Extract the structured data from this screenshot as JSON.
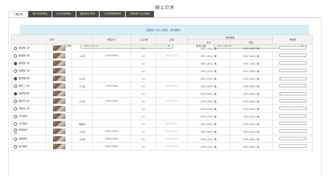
{
  "page_title": "線上訂房",
  "tabs": [
    "一般訂房",
    "親子四季專案",
    "日式柏城專案",
    "暢遊學生專案",
    "住宿連開餐專案",
    "寒假親子合住專案"
  ],
  "notice": "若要有×元住×優惠，請勿看見！",
  "checkin": {
    "label": "入住日期：",
    "value": "2017-05-11"
  },
  "checkout": {
    "label": "退房日期：",
    "value": "2017-05-12"
  },
  "table": {
    "headers": {
      "room": "房型",
      "size": "房間尺寸",
      "people": "入住人數",
      "full": "全價",
      "price_group": "優惠價格",
      "weekday": "平日",
      "holiday": "假日",
      "qty": "房間數"
    },
    "rows": [
      {
        "name": "雅致雙人房",
        "checked": false,
        "size": "",
        "bed": "",
        "people": "1人",
        "full": "",
        "weekday": "NT$ 2,650 / 晚",
        "holiday": "NT$ 2,960 / 晚",
        "qty": ""
      },
      {
        "name": "雅致雙人房",
        "checked": false,
        "size": "1大床",
        "bed": "150×190cm",
        "people": "2人",
        "full": "NT$ 4,200",
        "weekday": "NT$ 2,950 / 晚",
        "holiday": "NT$ 3,460 / 晚",
        "qty": ""
      },
      {
        "name": "雅致雙人房",
        "checked": true,
        "size": "",
        "bed": "",
        "people": "1人",
        "full": "",
        "weekday": "NT$ 2,850 / 晚",
        "holiday": "NT$ 3,160 / 晚",
        "qty": ""
      },
      {
        "name": "景緻雙人房",
        "checked": false,
        "size": "",
        "bed": "",
        "people": "2人",
        "full": "",
        "weekday": "NT$ 3,150 / 晚",
        "holiday": "NT$ 3,660 / 晚",
        "qty": ""
      },
      {
        "name": "雅致雙床房",
        "checked": true,
        "size": "2小床",
        "bed": "",
        "people": "1人",
        "full": "",
        "weekday": "NT$ 3,150 / 晚",
        "holiday": "NT$ 3,460 / 晚",
        "qty": "1"
      },
      {
        "name": "雅致三人房",
        "checked": false,
        "size": "2小床",
        "bed": "120×190cm",
        "people": "2人",
        "full": "NT$ 4,800",
        "weekday": "NT$ 3,000 / 晚",
        "holiday": "NT$ 3,960 / 晚",
        "qty": ""
      },
      {
        "name": "景緻雙床房",
        "checked": true,
        "size": "",
        "bed": "",
        "people": "2人",
        "full": "",
        "weekday": "NT$ 3,600 / 晚",
        "holiday": "NT$ 4,060 / 晚",
        "qty": "1"
      },
      {
        "name": "雅致四人房",
        "checked": false,
        "size": "2中床",
        "bed": "150×190cm",
        "people": "3人",
        "full": "NT$ 5,400",
        "weekday": "NT$ 3,600 / 晚",
        "holiday": "NT$ 4,060 / 晚",
        "qty": ""
      },
      {
        "name": "景緻四人房",
        "checked": false,
        "size": "",
        "bed": "",
        "people": "4人",
        "full": "",
        "weekday": "NT$ 4,000 / 晚",
        "holiday": "NT$ 4,560 / 晚",
        "qty": ""
      },
      {
        "name": "日式客房",
        "checked": false,
        "size": "",
        "bed": "",
        "people": "2人",
        "full": "",
        "weekday": "NT$ 3,700 / 晚",
        "holiday": "NT$ 4,260 / 晚",
        "qty": ""
      },
      {
        "name": "日式套房",
        "checked": false,
        "size": "榻榻米",
        "bed": "",
        "people": "3人",
        "full": "NT$ 5,800",
        "weekday": "NT$ 3,900 / 晚",
        "holiday": "NT$ 4,460 / 晚",
        "qty": ""
      },
      {
        "name": "精緻套房",
        "sub": "豪華",
        "checked": false,
        "size": "1大床",
        "bed": "150×190cm",
        "people": "2人",
        "full": "NT$ 5,400",
        "weekday": "NT$ 3,900 / 晚",
        "holiday": "NT$ 4,260 / 晚",
        "qty": ""
      },
      {
        "name": "豪華套房",
        "checked": false,
        "size": "1大床",
        "bed": "180×190cm",
        "people": "2人",
        "full": "NT$ 6,600",
        "weekday": "NT$ 4,200 / 晚",
        "holiday": "NT$ 4,860 / 晚",
        "qty": ""
      },
      {
        "name": "蜜月套房",
        "checked": false,
        "size": "",
        "bed": "180×190cm",
        "people": "2人",
        "full": "NT$ 8,000",
        "weekday": "NT$ 5,200 / 晚",
        "holiday": "NT$ 5,860 / 晚",
        "qty": ""
      }
    ]
  }
}
